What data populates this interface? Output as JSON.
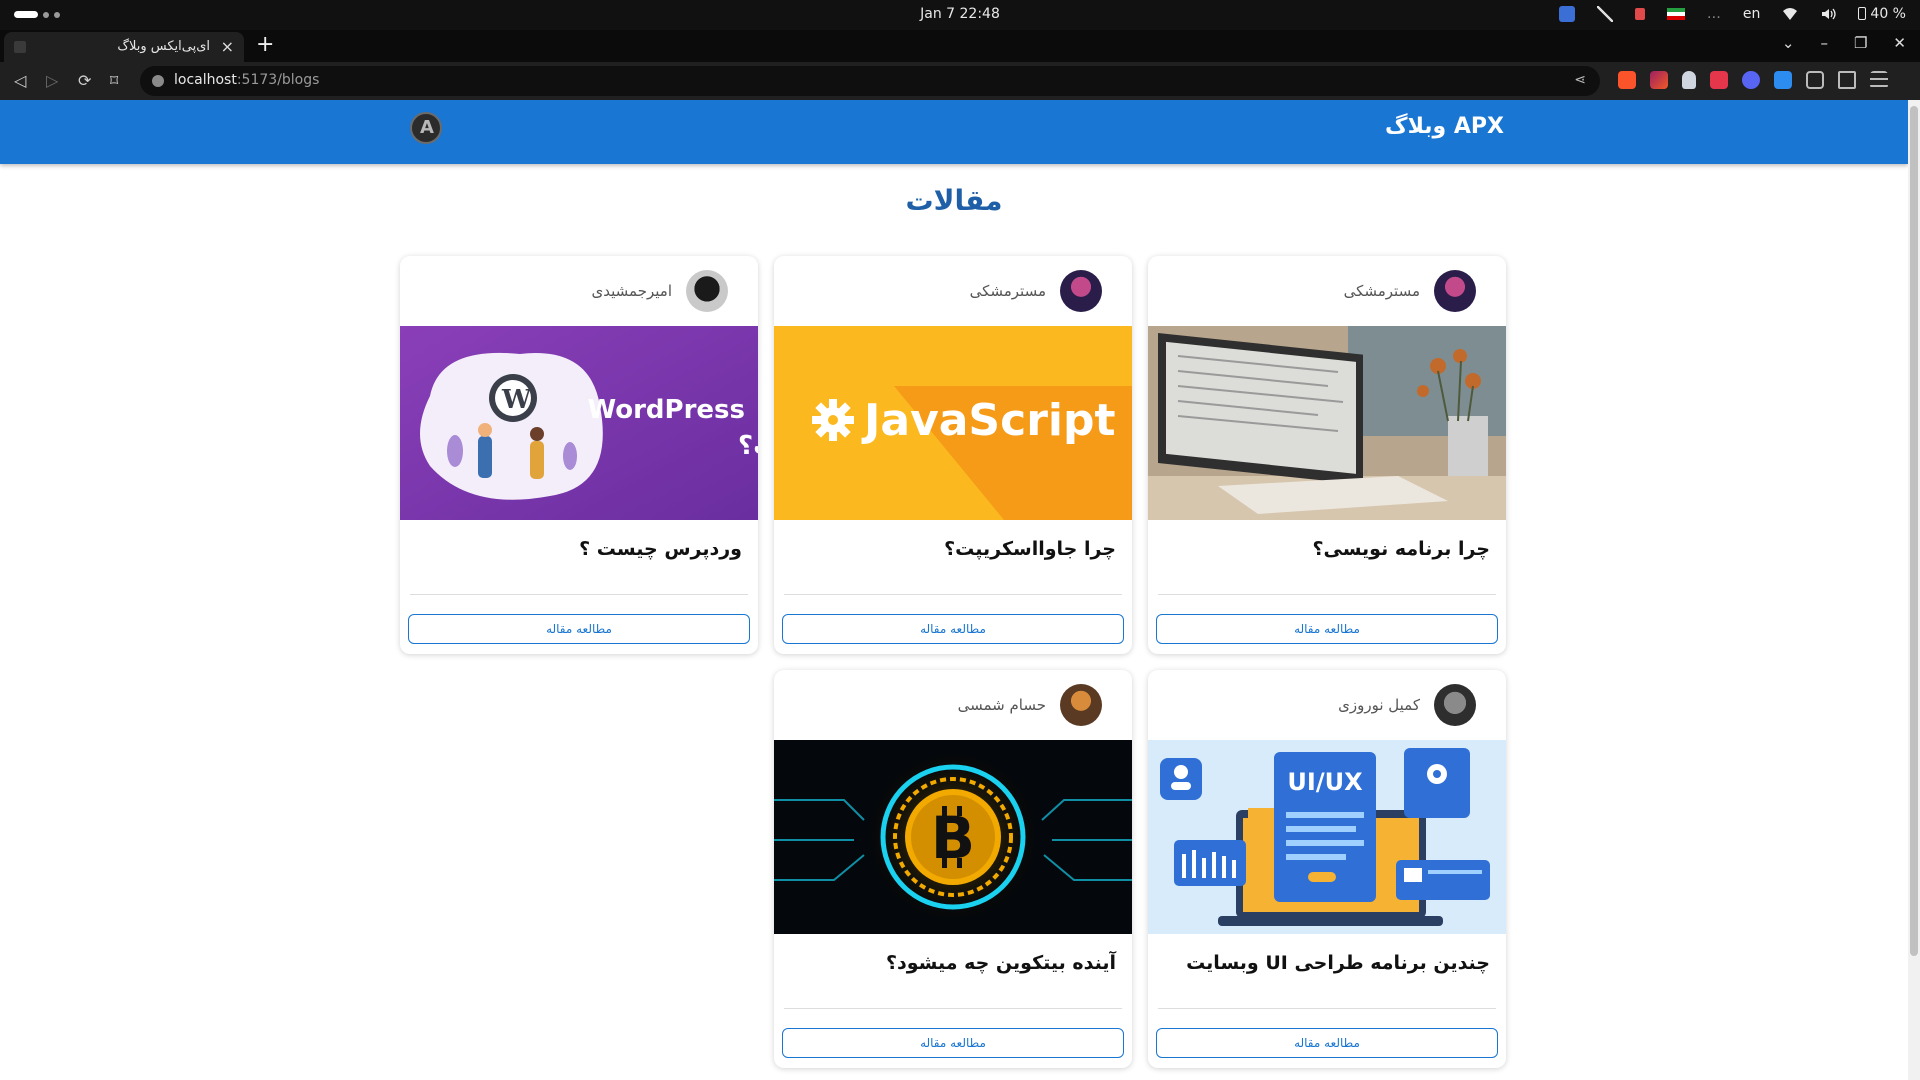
{
  "system": {
    "clock": "Jan 7  22:48",
    "keyboard_layout": "en",
    "battery": "40 %"
  },
  "browser": {
    "tab_title": "ای‌پی‌ایکس وبلاگ",
    "new_tab": "+",
    "tab_close": "×",
    "url_host": "localhost",
    "url_rest": ":5173/blogs"
  },
  "site": {
    "brand": "APX وبلاگ",
    "page_title": "مقالات",
    "accent_color": "#1976d2",
    "title_color": "#1e5fa8"
  },
  "posts": [
    {
      "author": "مسترمشکی",
      "title": "چرا برنامه نویسی؟",
      "button": "مطالعه مقاله",
      "image": "computer-desk"
    },
    {
      "author": "مسترمشکی",
      "title": "چرا جاوااسکریپت؟",
      "button": "مطالعه مقاله",
      "image": "javascript-banner",
      "image_text": "JavaScript"
    },
    {
      "author": "امیرجمشیدی",
      "title": "وردپرس چیست ؟",
      "button": "مطالعه مقاله",
      "image": "wordpress-banner",
      "image_text_1": "WordPress",
      "image_text_2": "چیست؟"
    },
    {
      "author": "کمیل نوروزی",
      "title": "چندین برنامه طراحی UI وبسایت",
      "button": "مطالعه مقاله",
      "image": "ui-ux-illustration",
      "image_text": "UI/UX"
    },
    {
      "author": "حسام شمسی",
      "title": "آینده بیتکوین چه میشود؟",
      "button": "مطالعه مقاله",
      "image": "bitcoin-circuit",
      "image_text": "B"
    }
  ]
}
